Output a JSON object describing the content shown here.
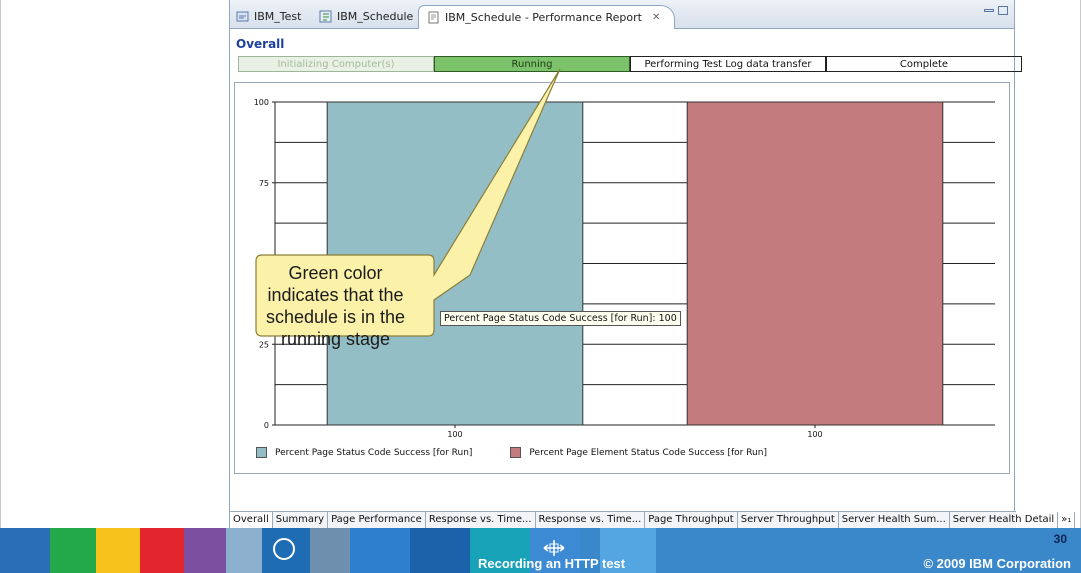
{
  "editor_tabs": [
    {
      "label": "IBM_Test",
      "icon": "test-icon"
    },
    {
      "label": "IBM_Schedule",
      "icon": "schedule-icon"
    },
    {
      "label": "IBM_Schedule - Performance Report",
      "icon": "report-icon",
      "close": "✕"
    }
  ],
  "overall_title": "Overall",
  "progress_stages": [
    {
      "label": "Initializing Computer(s)",
      "state": "done"
    },
    {
      "label": "Running",
      "state": "running"
    },
    {
      "label": "Performing Test Log data transfer",
      "state": "pending"
    },
    {
      "label": "Complete",
      "state": "pending"
    }
  ],
  "chart_data": {
    "type": "bar",
    "categories": [
      "100",
      "100"
    ],
    "series": [
      {
        "name": "Percent Page Status Code Success [for Run]",
        "values": [
          100
        ],
        "color": "#93bec6"
      },
      {
        "name": "Percent Page Element Status Code Success [for Run]",
        "values": [
          100
        ],
        "color": "#c47b7d"
      }
    ],
    "yticks": [
      "100",
      "75",
      "25",
      "0"
    ],
    "ylim": [
      0,
      100
    ],
    "grid": true,
    "legend": "bottom-left"
  },
  "tooltip": "Percent Page Status Code Success [for Run]: 100",
  "callout": "Green color indicates that the schedule is in the running stage",
  "bottom_tabs": [
    "Overall",
    "Summary",
    "Page Performance",
    "Response vs. Time...",
    "Response vs. Time...",
    "Page Throughput",
    "Server Throughput",
    "Server Health Sum...",
    "Server Health Detail",
    "»₁"
  ],
  "footer": {
    "title": "Recording an HTTP test",
    "page_number": "30",
    "copyright": "© 2009 IBM Corporation"
  },
  "colors": {
    "running": "#7cc26a",
    "series1": "#93bec6",
    "series2": "#c47b7d",
    "callout_fill": "#fbf1a8",
    "footer_blue": "#3a87c9"
  }
}
